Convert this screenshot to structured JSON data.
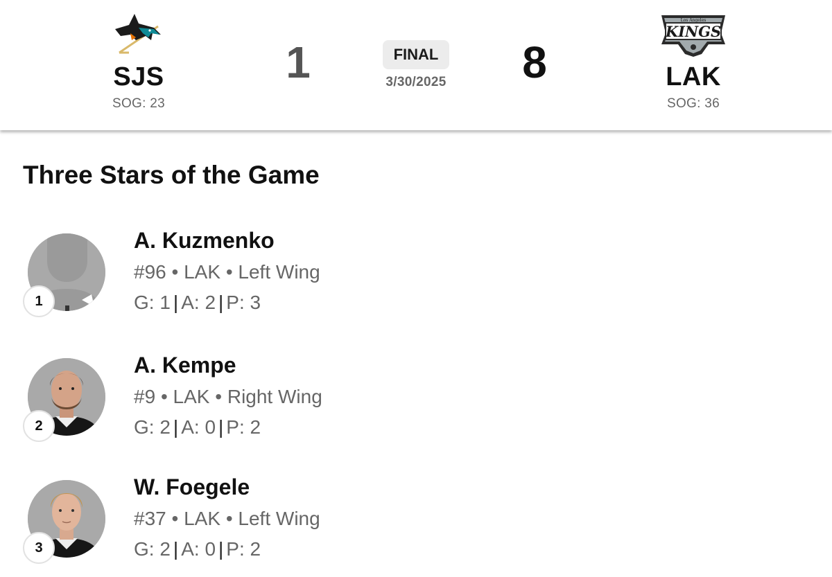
{
  "game": {
    "away": {
      "abbr": "SJS",
      "sog": "SOG: 23",
      "score": "1",
      "logo": "sharks-logo"
    },
    "home": {
      "abbr": "LAK",
      "sog": "SOG: 36",
      "score": "8",
      "logo": "kings-logo",
      "logo_small_text": "Los Angeles",
      "logo_text": "KINGS"
    },
    "status": "FINAL",
    "date": "3/30/2025"
  },
  "section_title": "Three Stars of the Game",
  "stars": [
    {
      "rank": "1",
      "name": "A. Kuzmenko",
      "number": "#96",
      "team": "LAK",
      "position": "Left Wing",
      "goals": "G: 1",
      "assists": "A: 2",
      "points": "P: 3",
      "avatar": "silhouette"
    },
    {
      "rank": "2",
      "name": "A. Kempe",
      "number": "#9",
      "team": "LAK",
      "position": "Right Wing",
      "goals": "G: 2",
      "assists": "A: 0",
      "points": "P: 2",
      "avatar": "headshot"
    },
    {
      "rank": "3",
      "name": "W. Foegele",
      "number": "#37",
      "team": "LAK",
      "position": "Left Wing",
      "goals": "G: 2",
      "assists": "A: 0",
      "points": "P: 2",
      "avatar": "headshot"
    }
  ],
  "colors": {
    "sharks_teal": "#0f8a95",
    "sharks_orange": "#e57200",
    "kings_silver": "#a2aaad",
    "text_muted": "#666666"
  }
}
